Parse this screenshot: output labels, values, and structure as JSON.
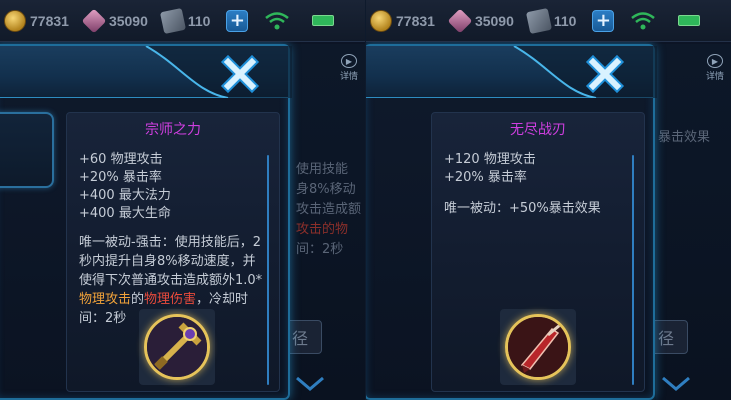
{
  "status": {
    "gold": "77831",
    "gems": "35090",
    "cards": "110",
    "plus_label": "+"
  },
  "background": {
    "detail_label": "详情",
    "path_label": "径",
    "left_lines": [
      "使用技能",
      "身8%移动",
      "攻击造成额",
      "攻击的物",
      "间：2秒"
    ],
    "right_lines": [
      "暴击效果"
    ]
  },
  "items": [
    {
      "name": "宗师之力",
      "stats": [
        "+60 物理攻击",
        "+20% 暴击率",
        "+400 最大法力",
        "+400 最大生命"
      ],
      "passive_intro": "唯一被动-强击：使用技能后，2秒内提升自身8%移动速度，并使得下次普通攻击造成额外1.0*",
      "passive_orange": "物理攻击",
      "passive_mid": "的",
      "passive_red": "物理伤害",
      "passive_end": "，冷却时间：2秒",
      "icon": "sword-hilt-icon"
    },
    {
      "name": "无尽战刃",
      "stats": [
        "+120 物理攻击",
        "+20% 暴击率"
      ],
      "passive": "唯一被动：+50%暴击效果",
      "icon": "crimson-blade-icon"
    }
  ],
  "colors": {
    "item_name": "#cf3fe0",
    "orange_text": "#f0a23a",
    "red_text": "#ea4b3c",
    "frame_glow": "#2d8cc0"
  }
}
